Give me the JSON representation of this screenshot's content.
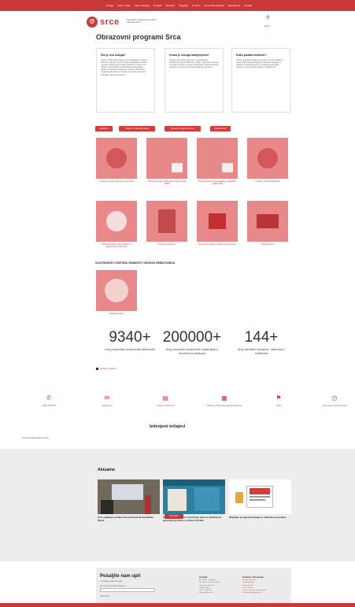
{
  "nav": {
    "items": [
      "Usluge",
      "Nexto Leaks",
      "Kako sudjeluju",
      "Projekti",
      "Aktualno",
      "Događaji",
      "O nama",
      "Korisnička podrška",
      "Zaposlenici",
      "Kontakt"
    ]
  },
  "brand": {
    "logo_text": "srce",
    "subtitle": "Sveučilište u Zagrebu Sveučilišni računski centar",
    "lang": "ENG"
  },
  "page_title": "Obrazovni programi Srca",
  "info_boxes": [
    {
      "title": "Što je ova usluga?",
      "text": "U okviru Obrazovnih programa Srca održavaju se tečajevi i radionice, webinari i stručni skupovi za djelatnike sustava znanosti i visokog obrazovanja. Sadržaji su usmjereni na primjenu informacijskih i komunikacijskih tehnologija u nastavi, istraživanju i poslovanju. U sklopu Obrazovnih programa korisnicima su dostupni i priručnici i obrazovni materijali u otvorenom pristupu."
    },
    {
      "title": "Komu je usluga namijenjena?",
      "text": "Obrazovni programi namijenjeni su nastavnicima, istraživačima, administrativnom osoblju i studentima ustanova iz sustava znanosti i visokog obrazovanja. Pojedine aktivnosti dostupne su i korisnicima izvan akademske zajednice."
    },
    {
      "title": "Kako postati korisnik?",
      "text": "Prijave na pojedine tečajeve provode se putem sustava za prijavu. Popis aktualnih tečajeva i radionica objavljuje se redovito na stranicama Srca, a za dodatne informacije korisnici se mogu obratiti na adresu edu@srce.hr."
    }
  ],
  "filters": [
    "Radionice",
    "Tečajevi za stjecanje znanja",
    "Tečajevi za naprednu razinu",
    "Webinari Srca"
  ],
  "tiles": [
    "Osnove uporabe računala i interneta",
    "Web tehnologije, izrada web stranica i web grafika",
    "Programiranje, baze podataka, statistički i grafički alati",
    "Uredski i multimedijski alati",
    "Platforme alati i druge podrške u akademskom okruženju",
    "Znanstveni skupovi",
    "Primjena e-učenja u obrazovnom procesu",
    "Webinari Srca"
  ],
  "section_heading": "ZA USTANOVE U SUSTAVU ZNANOSTI I VISOKOG OBRAZOVANJA",
  "institution_tile": "Akademija Srca",
  "stats": [
    {
      "number": "9340+",
      "label": "broj polaznika obrazovnih aktivnosti"
    },
    {
      "number": "200000+",
      "label": "broj preuzetih obrazovnih materijala u otvorenom pristupu"
    },
    {
      "number": "144+",
      "label": "broj održanih tečajeva, radionica i webinara"
    }
  ],
  "tag_label": "Digitalne vještine",
  "contacts": [
    {
      "icon": "phone-icon",
      "text": "+385 1 6165 165"
    },
    {
      "icon": "mail-icon",
      "text": "edu@srce.hr"
    },
    {
      "icon": "document-icon",
      "text": "Pravilnici i dokumenti"
    },
    {
      "icon": "calendar-icon",
      "text": "Raspored održavanja tečajeva i radionica"
    },
    {
      "icon": "tag-icon",
      "text": "Cjenik"
    },
    {
      "icon": "clock-icon",
      "text": "radno vrijeme od 8 do 16 sati"
    }
  ],
  "featured_heading": "Izdvojeni tečajevi",
  "small_note": "Trenutno nema tečajeva u ispisu",
  "news": {
    "heading": "Aktualno",
    "cards": [
      {
        "title": "Srce sudjeluje u Doktorskoj konferenciji Sveučilišta Sjever"
      },
      {
        "title": "Održan webinar Srca o korištenju alata za detekciju AI generiranog teksta u softveru Turnitin"
      },
      {
        "title": "Objavljen je raspored tečajeva i radionica za proljeće"
      }
    ],
    "more_label": "Više vijesti"
  },
  "contact_form": {
    "title": "Pošaljite nam upit",
    "hint": "* Označena obavezna polja",
    "name_label": "Ime i prezime ili naziv ustanove *",
    "subject_label": "Naziv upita*",
    "col1_title": "Kontakt",
    "col1_lines": [
      "Sveučilište u Zagrebu",
      "Sveučilišni računski centar",
      "Josipa Marohnića 5",
      "10000 Zagreb",
      "+385 1 6165 555",
      "helpdesk@srce.hr"
    ],
    "col2_title": "Dodatne informacije",
    "col2_lines": [
      "Politika privatnosti",
      "Uvjeti korištenja",
      "Pristupačnost",
      "Javna nabava",
      "Pravo na pristup informacijama",
      "Zaštita osobnih podataka"
    ]
  },
  "colors": {
    "accent": "#c83a3a",
    "tile": "#e8888a",
    "band": "#ededed"
  }
}
